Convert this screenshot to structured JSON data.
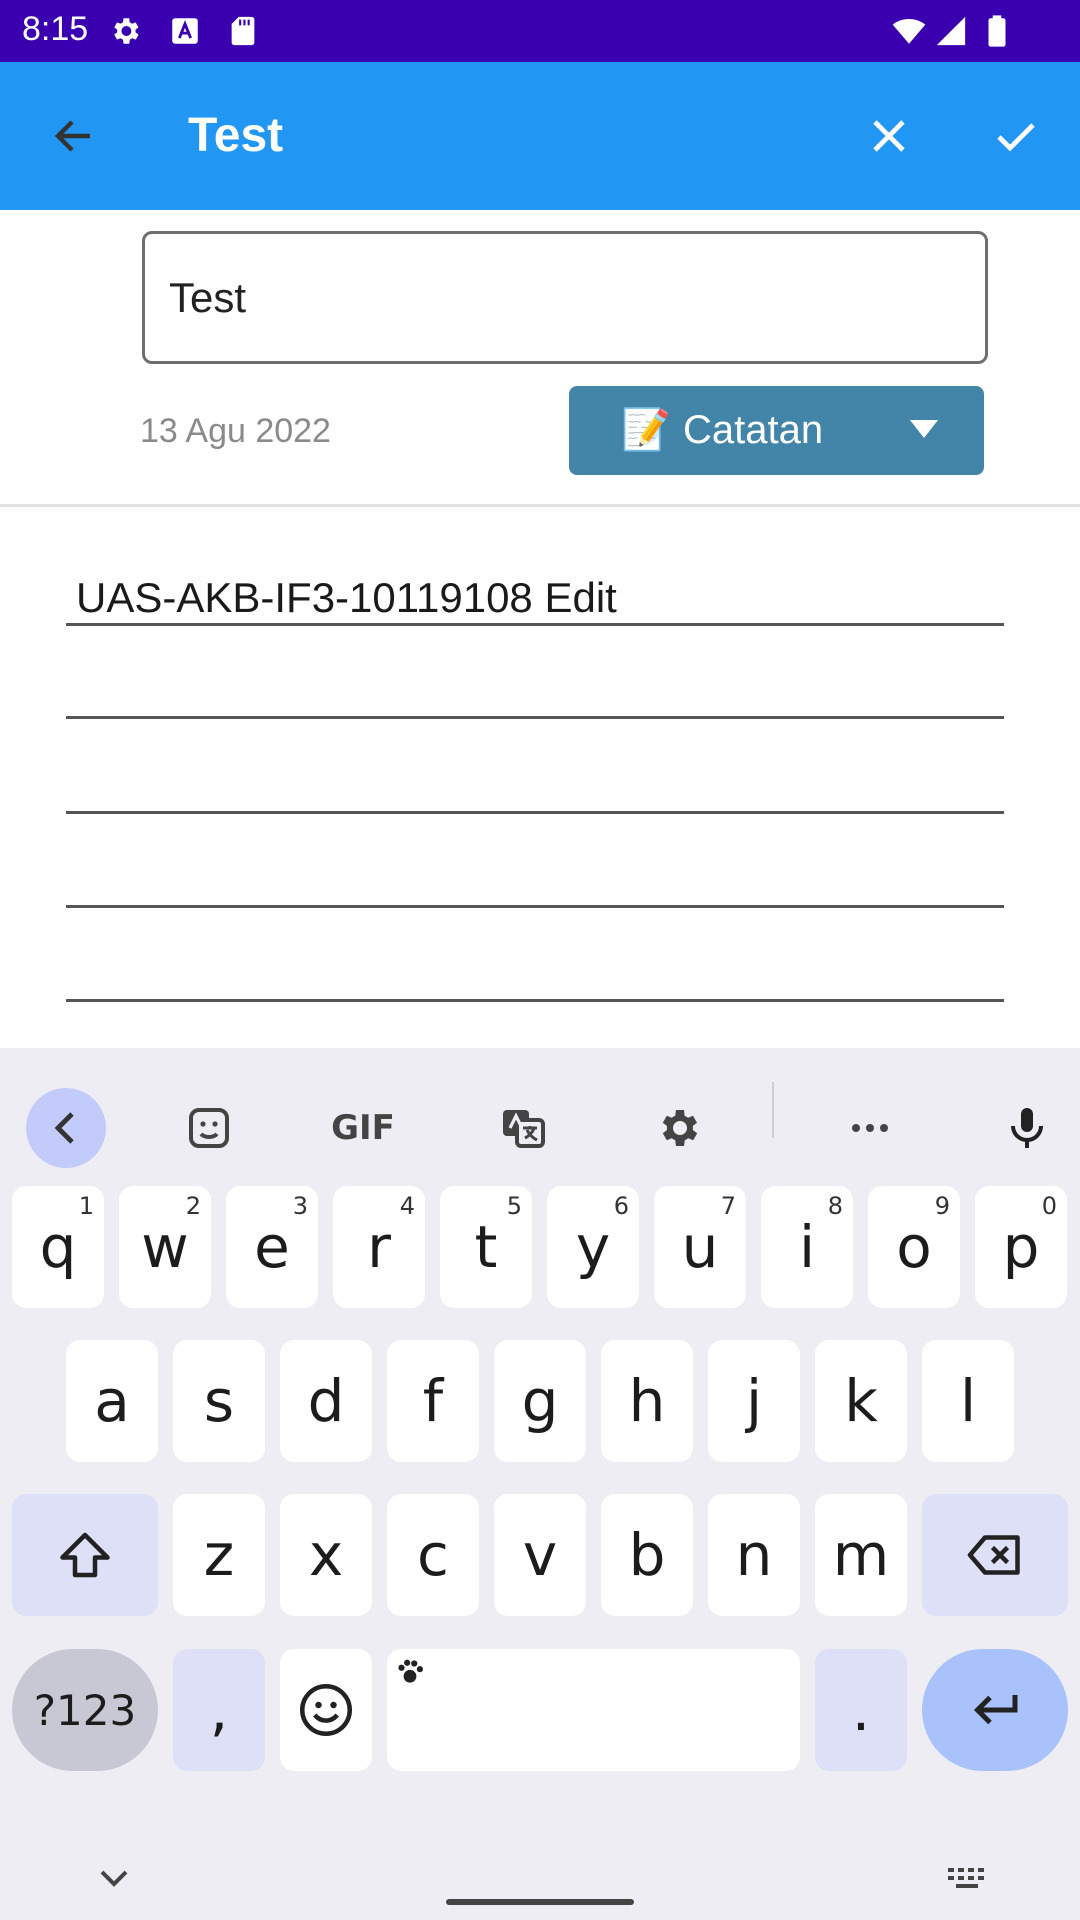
{
  "status_bar": {
    "time": "8:15",
    "icons": [
      "settings-icon",
      "a-badge-icon",
      "sd-card-icon",
      "wifi-icon",
      "signal-icon",
      "battery-icon"
    ],
    "background": "#3a00b0"
  },
  "app_bar": {
    "title": "Test",
    "background": "#2196f3",
    "icons": [
      "back-arrow-icon",
      "close-icon",
      "check-icon"
    ]
  },
  "form": {
    "title_value": "Test",
    "date": "13 Agu 2022",
    "category": {
      "emoji": "📝",
      "label": "Catatan",
      "background": "#4385a8"
    }
  },
  "note": {
    "lines": [
      "UAS-AKB-IF3-10119108 Edit",
      "",
      "",
      "",
      ""
    ]
  },
  "keyboard": {
    "toolbar": [
      "back-icon",
      "sticker-icon",
      "GIF",
      "translate-icon",
      "settings-icon",
      "more-icon",
      "mic-icon"
    ],
    "row1": [
      {
        "key": "q",
        "hint": "1"
      },
      {
        "key": "w",
        "hint": "2"
      },
      {
        "key": "e",
        "hint": "3"
      },
      {
        "key": "r",
        "hint": "4"
      },
      {
        "key": "t",
        "hint": "5"
      },
      {
        "key": "y",
        "hint": "6"
      },
      {
        "key": "u",
        "hint": "7"
      },
      {
        "key": "i",
        "hint": "8"
      },
      {
        "key": "o",
        "hint": "9"
      },
      {
        "key": "p",
        "hint": "0"
      }
    ],
    "row2": [
      "a",
      "s",
      "d",
      "f",
      "g",
      "h",
      "j",
      "k",
      "l"
    ],
    "row3": [
      "z",
      "x",
      "c",
      "v",
      "b",
      "n",
      "m"
    ],
    "row4": {
      "symbols": "?123",
      "comma": ",",
      "period": "."
    },
    "accent": "#a9c2fb"
  }
}
